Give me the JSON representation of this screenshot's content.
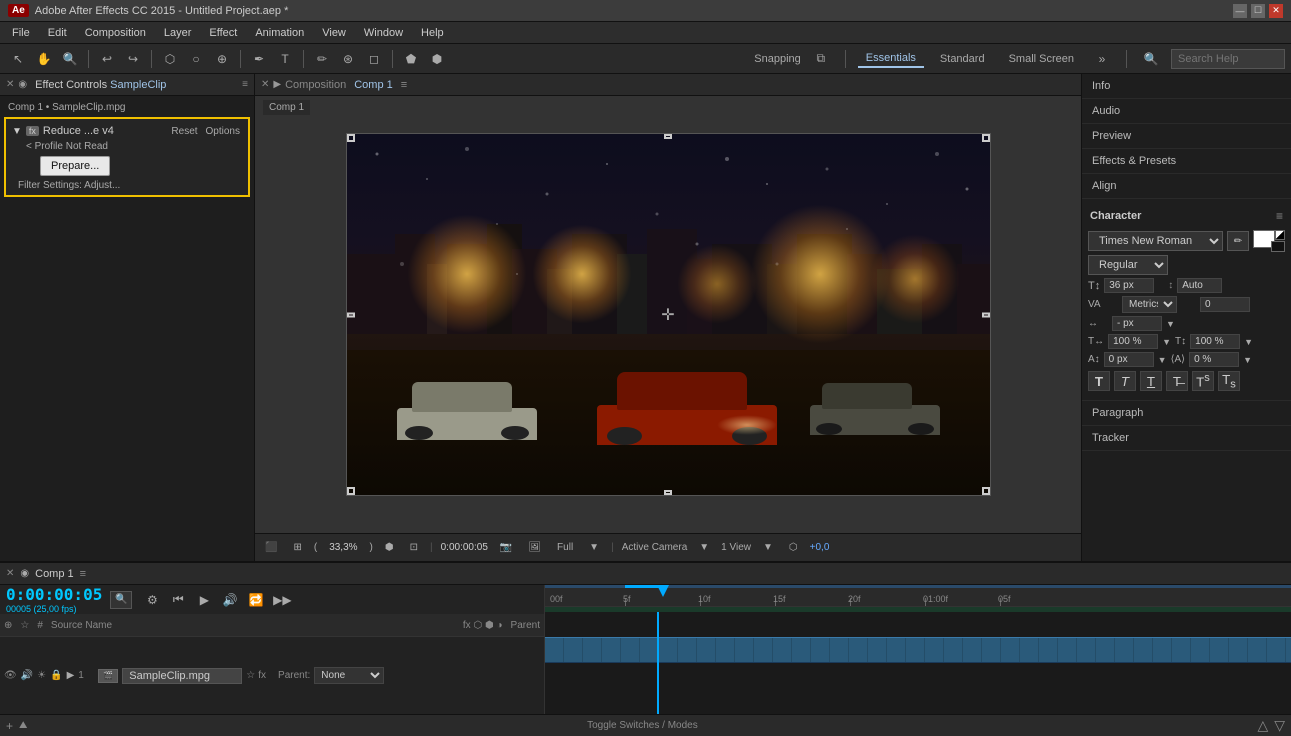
{
  "app": {
    "title": "Adobe After Effects CC 2015 - Untitled Project.aep *",
    "icon": "AE"
  },
  "titlebar": {
    "title": "Adobe After Effects CC 2015 - Untitled Project.aep *",
    "min": "—",
    "max": "☐",
    "close": "✕"
  },
  "menubar": {
    "items": [
      "File",
      "Edit",
      "Composition",
      "Layer",
      "Effect",
      "Animation",
      "View",
      "Window",
      "Help"
    ]
  },
  "toolbar": {
    "snapping_label": "Snapping",
    "workspaces": [
      "Essentials",
      "Standard",
      "Small Screen"
    ],
    "active_workspace": "Essentials",
    "search_placeholder": "Search Help"
  },
  "effect_controls": {
    "panel_title": "Effect Controls",
    "clip_name": "SampleClip",
    "source_label": "Comp 1 • SampleClip.mpg",
    "effect_name": "Reduce ...e v4",
    "reset_btn": "Reset",
    "options_btn": "Options",
    "profile_note": "< Profile Not Read",
    "prepare_btn": "Prepare...",
    "filter_settings": "Filter Settings:",
    "adjust_label": "Adjust..."
  },
  "composition": {
    "panel_title": "Composition",
    "comp_name": "Comp 1",
    "tab_label": "Comp 1",
    "menu_icon": "≡",
    "time": "0:00:00:05",
    "zoom": "33,3%",
    "quality": "Full",
    "view": "Active Camera",
    "view_count": "1 View",
    "offset": "+0,0"
  },
  "right_panel": {
    "items": [
      {
        "id": "info",
        "label": "Info"
      },
      {
        "id": "audio",
        "label": "Audio"
      },
      {
        "id": "preview",
        "label": "Preview"
      },
      {
        "id": "effects_presets",
        "label": "Effects & Presets"
      },
      {
        "id": "align",
        "label": "Align"
      },
      {
        "id": "character",
        "label": "Character"
      },
      {
        "id": "paragraph",
        "label": "Paragraph"
      },
      {
        "id": "tracker",
        "label": "Tracker"
      }
    ],
    "character": {
      "title": "Character",
      "menu_icon": "≡",
      "font": "Times New Roman",
      "style": "Regular",
      "size": "36 px",
      "size_auto": "Auto",
      "tracking_type": "Metrics",
      "tracking_val": "0",
      "leading_unit": "- px",
      "tsf_h": "100 %",
      "tsf_v": "100 %",
      "baseline_shift": "0 px",
      "tsf_skew": "0 %"
    }
  },
  "timeline": {
    "comp_name": "Comp 1",
    "time": "0:00:00:05",
    "fps_label": "00005 (25,00 fps)",
    "columns": [
      "#",
      "Source Name",
      "⊕ ☆ fx ☐ ● ◎",
      "Parent"
    ],
    "layers": [
      {
        "num": "1",
        "name": "SampleClip.mpg",
        "parent": "None"
      }
    ],
    "ruler_marks": [
      "00f",
      "5f",
      "10f",
      "15f",
      "20f",
      "01:00f",
      "05f"
    ],
    "footer": "Toggle Switches / Modes"
  }
}
